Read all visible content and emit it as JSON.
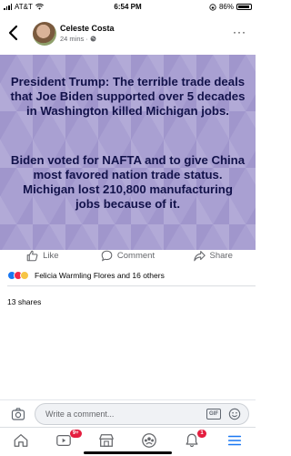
{
  "status_bar": {
    "carrier": "AT&T",
    "time": "6:54 PM",
    "battery": "86%"
  },
  "post": {
    "author": "Celeste Costa",
    "meta": "24 mins ·",
    "image_text": [
      "President Trump: The terrible trade deals that Joe Biden supported over 5 decades in Washington killed Michigan jobs.",
      "Biden voted for NAFTA and to give China most favored nation trade status. Michigan lost 210,800 manufacturing jobs because of it."
    ],
    "image_bg_color": "#a9a0d2",
    "text_color": "#12124a"
  },
  "actions": {
    "like": "Like",
    "comment": "Comment",
    "share": "Share"
  },
  "reactions": {
    "summary": "Felicia Warmling Flores and 16 others",
    "icons": [
      "like",
      "love",
      "sad"
    ]
  },
  "shares": "13 shares",
  "comment_bar": {
    "placeholder": "Write a comment...",
    "gif": "GIF"
  },
  "tabs": [
    {
      "name": "home",
      "badge": ""
    },
    {
      "name": "video",
      "badge": "9+"
    },
    {
      "name": "marketplace",
      "badge": ""
    },
    {
      "name": "groups",
      "badge": ""
    },
    {
      "name": "notifications",
      "badge": "1"
    },
    {
      "name": "menu",
      "badge": ""
    }
  ],
  "accent_color": "#1877f2"
}
